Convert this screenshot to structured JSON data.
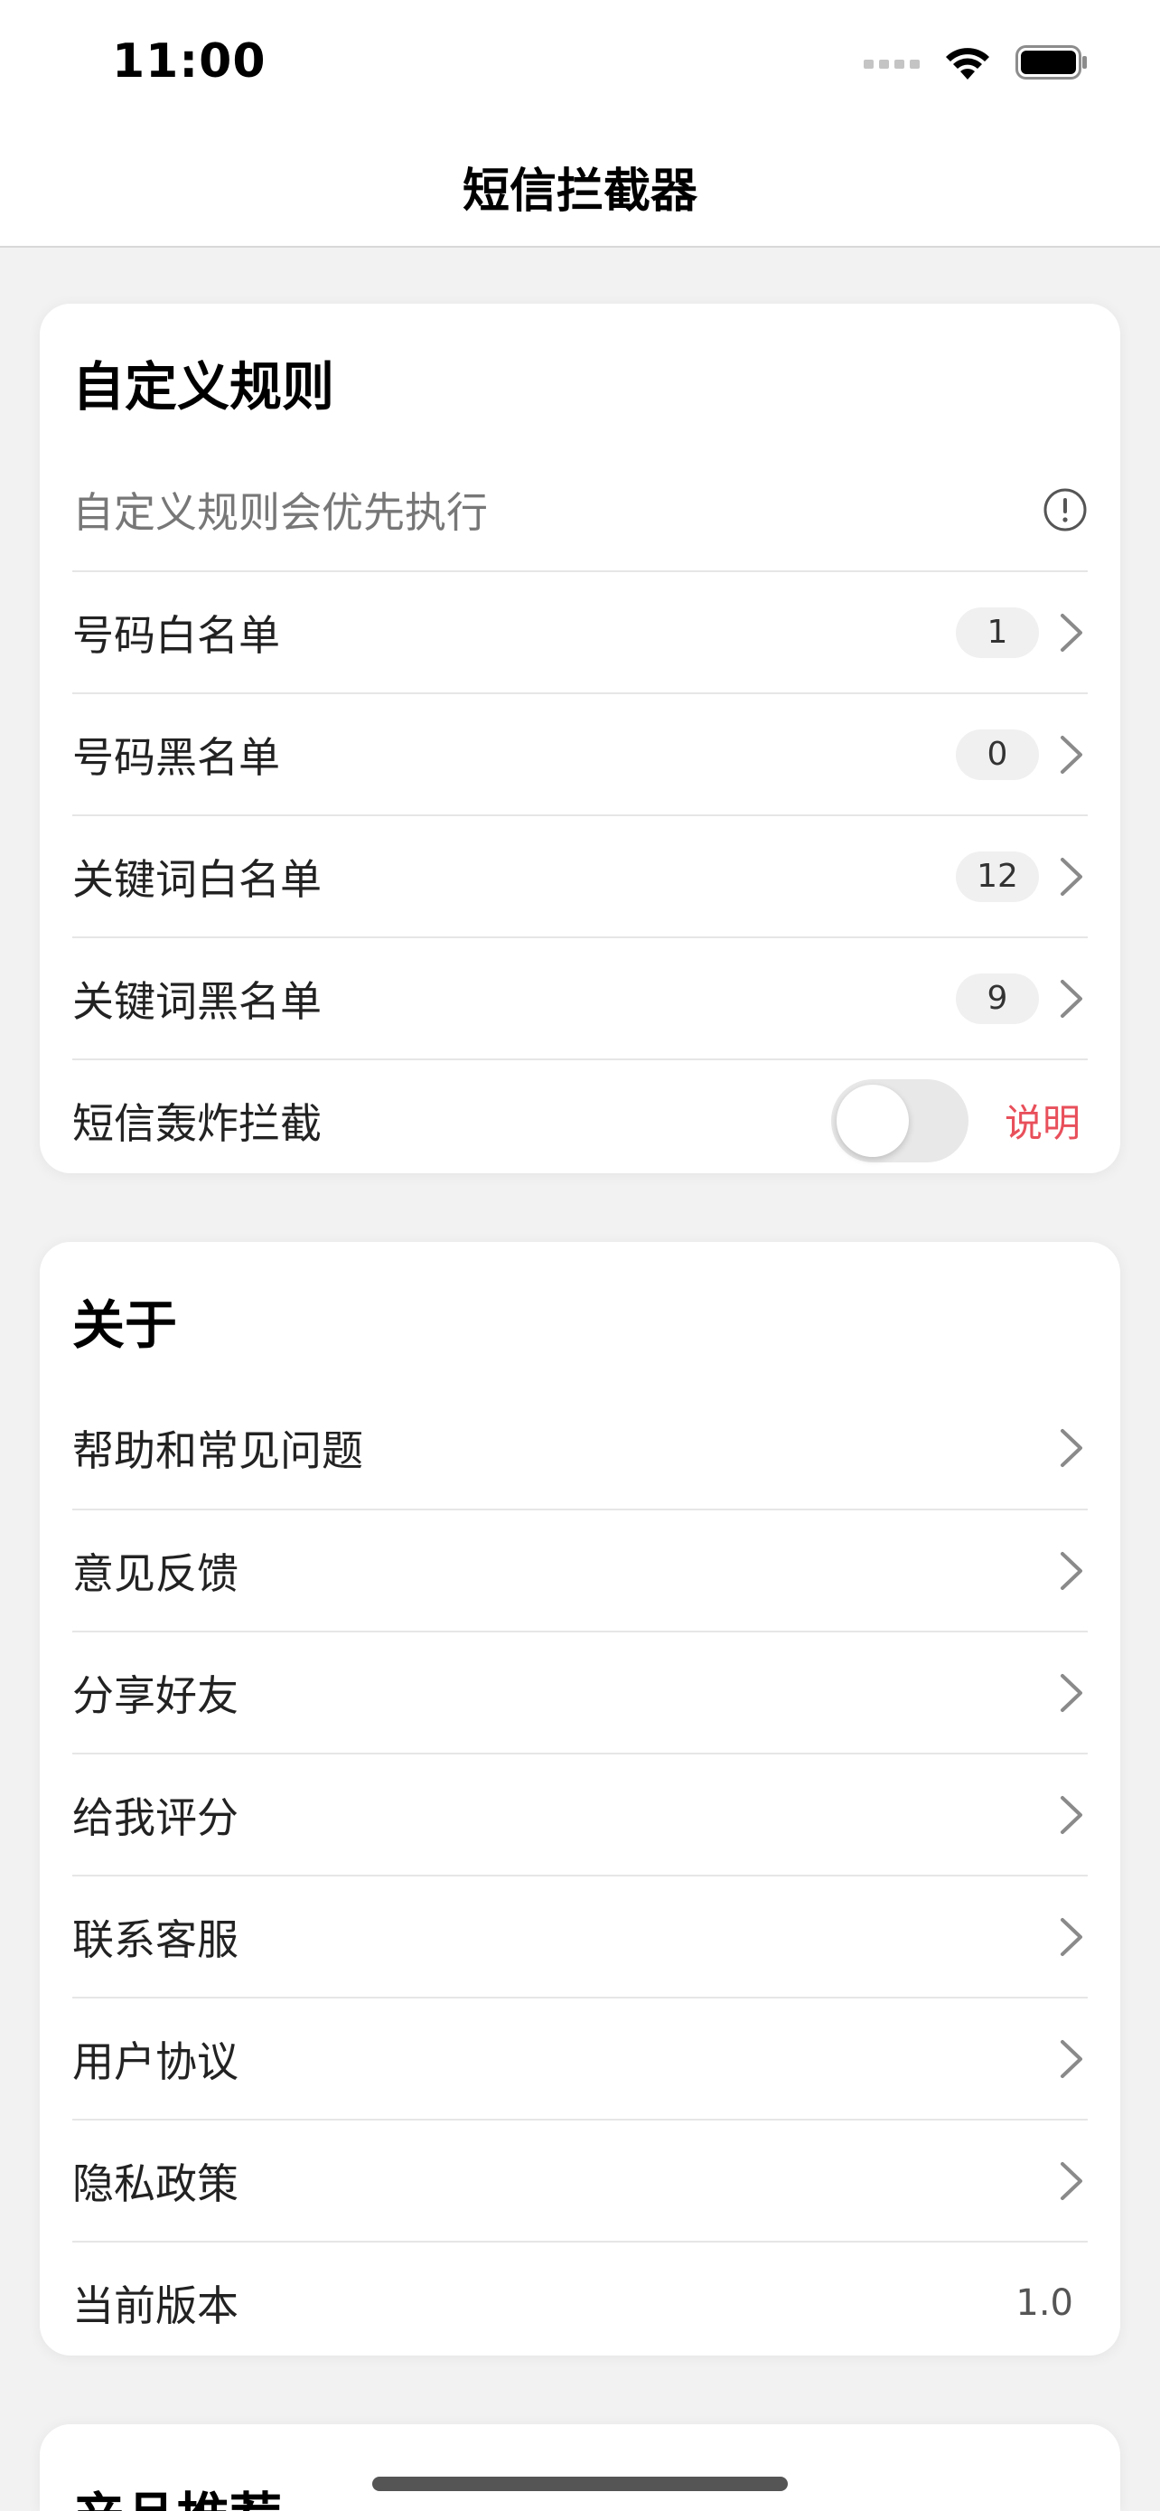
{
  "status_bar": {
    "time": "11:00"
  },
  "nav": {
    "title": "短信拦截器"
  },
  "custom_rules": {
    "title": "自定义规则",
    "note": "自定义规则会优先执行",
    "items": [
      {
        "label": "号码白名单",
        "count": "1"
      },
      {
        "label": "号码黑名单",
        "count": "0"
      },
      {
        "label": "关键词白名单",
        "count": "12"
      },
      {
        "label": "关键词黑名单",
        "count": "9"
      }
    ],
    "bomb_block": {
      "label": "短信轰炸拦截",
      "enabled": false,
      "explain_label": "说明"
    }
  },
  "about": {
    "title": "关于",
    "items": [
      {
        "label": "帮助和常见问题"
      },
      {
        "label": "意见反馈"
      },
      {
        "label": "分享好友"
      },
      {
        "label": "给我评分"
      },
      {
        "label": "联系客服"
      },
      {
        "label": "用户协议"
      },
      {
        "label": "隐私政策"
      }
    ],
    "version": {
      "label": "当前版本",
      "value": "1.0"
    }
  },
  "products": {
    "title": "产品推荐"
  },
  "colors": {
    "accent_red": "#e8505b",
    "background": "#f2f2f2",
    "card": "#ffffff"
  },
  "icons": {
    "info": "info-circle-icon",
    "chevron": "chevron-right-icon",
    "wifi": "wifi-icon",
    "battery": "battery-icon",
    "signal": "cellular-signal-icon"
  }
}
